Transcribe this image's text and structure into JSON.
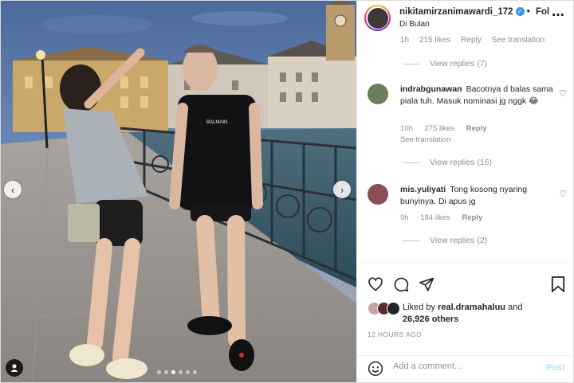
{
  "post": {
    "username": "nikitamirzanimawardi_172",
    "follow_label": "Fol",
    "location": "Di Bulan",
    "more_icon": "more-icon"
  },
  "top_partial": {
    "time": "1h",
    "likes": "215 likes",
    "reply": "Reply",
    "see_translation": "See translation"
  },
  "view_replies": [
    "View replies (7)",
    "View replies (16)",
    "View replies (2)"
  ],
  "comments": [
    {
      "username": "indrabgunawan",
      "text": "Bacotnya d balas sama piala tuh. Masuk nominasi jg nggk 😂",
      "time": "10h",
      "likes": "275 likes",
      "reply": "Reply",
      "see_translation": "See translation"
    },
    {
      "username": "mis.yuliyati",
      "text": "Tong kosong nyaring bunyinya. Di apus jg",
      "time": "9h",
      "likes": "184 likes",
      "reply": "Reply"
    }
  ],
  "liked_by": {
    "prefix": "Liked by",
    "user": "real.dramahaluu",
    "and": "and",
    "others": "26,926 others"
  },
  "timestamp": "12 HOURS AGO",
  "add_comment": {
    "placeholder": "Add a comment...",
    "post_label": "Post"
  },
  "carousel": {
    "total": 6,
    "active_index": 2
  },
  "photo_text": {
    "shirt_logo": "BALMAIN"
  },
  "colors": {
    "verified": "#3897f0",
    "post_disabled": "#b2dffc",
    "muted_text": "#8e8e8e"
  }
}
